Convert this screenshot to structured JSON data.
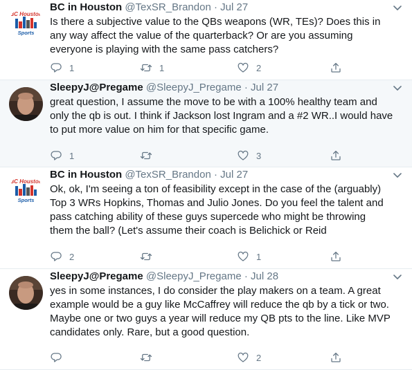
{
  "tweets": [
    {
      "name": "BC in Houston",
      "handle": "@TexSR_Brandon",
      "separator": "·",
      "date": "Jul 27",
      "avatar": {
        "type": "logo",
        "logo_top": "BC Houston",
        "logo_bottom": "Sports"
      },
      "lines": [
        "Is there a subjective value to the QBs weapons (WR, TEs)? Does this in",
        "any way affect the value of the quarterback? Or are you assuming",
        "everyone is playing with the same pass catchers?"
      ],
      "replies": "1",
      "retweets": "1",
      "likes": "2",
      "highlighted": false
    },
    {
      "name": "SleepyJ@Pregame",
      "handle": "@SleepyJ_Pregame",
      "separator": "·",
      "date": "Jul 27",
      "avatar": {
        "type": "photo"
      },
      "lines": [
        "great question, I assume the move to be with a 100% healthy team and",
        "only the qb is out. I think if Jackson lost Ingram and a #2 WR..I would have",
        "to put more value on him for that specific game."
      ],
      "replies": "1",
      "retweets": "",
      "likes": "3",
      "highlighted": true
    },
    {
      "name": "BC in Houston",
      "handle": "@TexSR_Brandon",
      "separator": "·",
      "date": "Jul 27",
      "avatar": {
        "type": "logo",
        "logo_top": "BC Houston",
        "logo_bottom": "Sports"
      },
      "lines": [
        "Ok, ok, I'm seeing a ton of feasibility except in the case of the (arguably)",
        "Top 3 WRs Hopkins, Thomas and Julio Jones. Do you feel the talent and",
        "pass catching ability of these guys supercede who might be throwing",
        "them the ball? (Let's assume their coach is Belichick or Reid"
      ],
      "replies": "2",
      "retweets": "",
      "likes": "1",
      "highlighted": false
    },
    {
      "name": "SleepyJ@Pregame",
      "handle": "@SleepyJ_Pregame",
      "separator": "·",
      "date": "Jul 28",
      "avatar": {
        "type": "photo"
      },
      "lines": [
        "yes in some instances, I do consider the play makers on a team. A great",
        "example would be a guy like McCaffrey will reduce the qb by a tick or two.",
        "Maybe one or two guys a year will reduce my QB pts to the line. Like MVP",
        "candidates only. Rare, but a good question."
      ],
      "replies": "",
      "retweets": "",
      "likes": "2",
      "highlighted": false
    }
  ],
  "colors": {
    "text": "#14171a",
    "muted": "#657786",
    "border": "#e6ecf0",
    "highlight_bg": "#f5f8fa",
    "logo_red": "#d4342c",
    "logo_blue": "#1a5ca8"
  },
  "icons": [
    "reply-icon",
    "retweet-icon",
    "like-icon",
    "share-icon",
    "chevron-down-icon"
  ]
}
